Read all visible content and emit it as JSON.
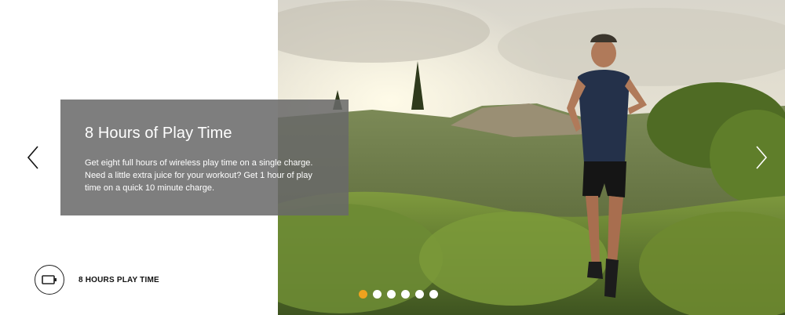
{
  "slide": {
    "title": "8 Hours of Play Time",
    "body": "Get eight full hours of wireless play time on a single charge. Need a little extra juice for your workout? Get 1 hour of play time on a quick 10 minute charge."
  },
  "feature": {
    "icon": "battery-icon",
    "label": "8 HOURS PLAY TIME"
  },
  "carousel": {
    "prev_icon": "chevron-left-icon",
    "next_icon": "chevron-right-icon",
    "total_slides": 6,
    "active_index": 0
  },
  "colors": {
    "accent": "#f0a21e",
    "caption_bg": "#696969"
  }
}
